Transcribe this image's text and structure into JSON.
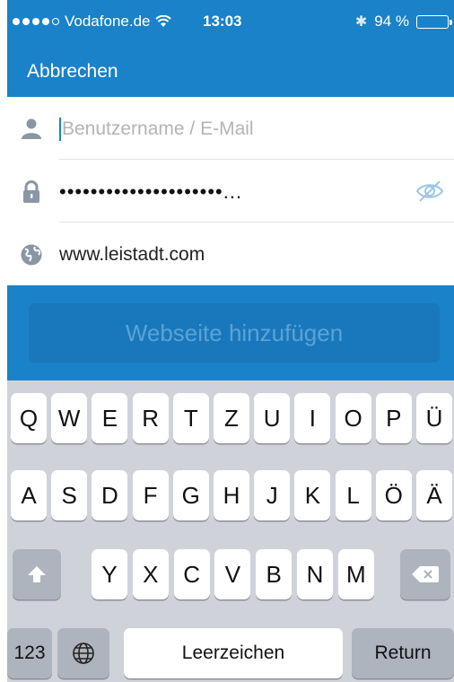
{
  "status_bar": {
    "carrier": "Vodafone.de",
    "time": "13:03",
    "battery_percent": "94 %",
    "battery_level": 0.94,
    "signal_bars_filled": 4,
    "signal_bars_total": 5
  },
  "nav": {
    "cancel_label": "Abbrechen"
  },
  "form": {
    "username_placeholder": "Benutzername / E-Mail",
    "username_value": "",
    "password_masked": "•••••••••••••••••••••...",
    "url_value": "www.leistadt.com"
  },
  "add_button": {
    "label": "Webseite hinzufügen"
  },
  "keyboard": {
    "row1": [
      "Q",
      "W",
      "E",
      "R",
      "T",
      "Z",
      "U",
      "I",
      "O",
      "P",
      "Ü"
    ],
    "row2": [
      "A",
      "S",
      "D",
      "F",
      "G",
      "H",
      "J",
      "K",
      "L",
      "Ö",
      "Ä"
    ],
    "row3": [
      "Y",
      "X",
      "C",
      "V",
      "B",
      "N",
      "M"
    ],
    "numbers_label": "123",
    "space_label": "Leerzeichen",
    "return_label": "Return"
  },
  "colors": {
    "accent": "#1a82c8",
    "keyboard_bg": "#cfd3d9",
    "icon_gray": "#8a96a4"
  }
}
